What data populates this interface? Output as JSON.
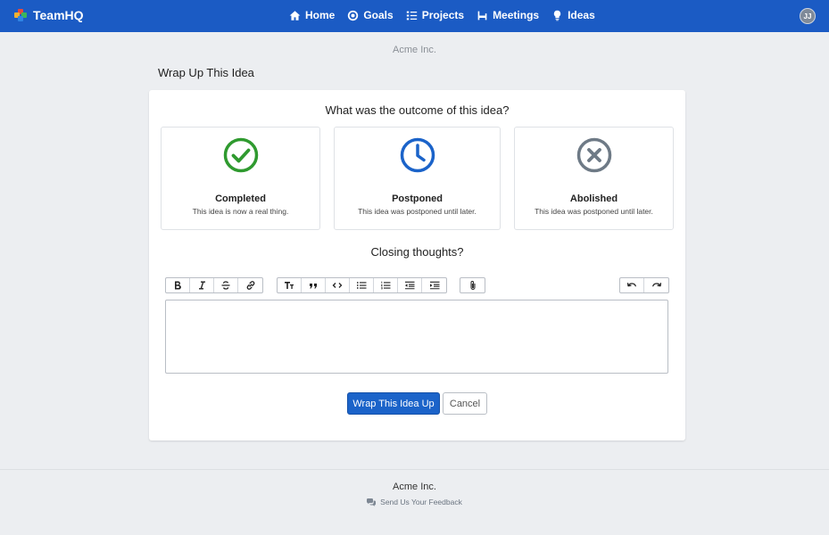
{
  "app": {
    "name": "TeamHQ",
    "user_initials": "JJ"
  },
  "nav": {
    "items": [
      {
        "label": "Home",
        "icon": "home-icon"
      },
      {
        "label": "Goals",
        "icon": "target-icon"
      },
      {
        "label": "Projects",
        "icon": "list-icon"
      },
      {
        "label": "Meetings",
        "icon": "chair-icon"
      },
      {
        "label": "Ideas",
        "icon": "lightbulb-icon"
      }
    ]
  },
  "org_name": "Acme Inc.",
  "page_title": "Wrap Up This Idea",
  "outcome": {
    "question": "What was the outcome of this idea?",
    "options": [
      {
        "title": "Completed",
        "description": "This idea is now a real thing.",
        "icon": "check-circle-icon",
        "color": "#2f9a2f"
      },
      {
        "title": "Postponed",
        "description": "This idea was postponed until later.",
        "icon": "clock-icon",
        "color": "#1b63c9"
      },
      {
        "title": "Abolished",
        "description": "This idea was postponed until later.",
        "icon": "x-circle-icon",
        "color": "#6e7a86"
      }
    ]
  },
  "closing": {
    "label": "Closing thoughts?",
    "editor_value": "",
    "toolbar": [
      [
        "bold-icon",
        "italic-icon",
        "strikethrough-icon",
        "link-icon"
      ],
      [
        "heading-icon",
        "quote-icon",
        "code-icon",
        "bullet-list-icon",
        "numbered-list-icon",
        "outdent-icon",
        "indent-icon"
      ],
      [
        "attach-icon"
      ],
      [
        "undo-icon",
        "redo-icon"
      ]
    ]
  },
  "actions": {
    "submit_label": "Wrap This Idea Up",
    "cancel_label": "Cancel"
  },
  "footer": {
    "org_name": "Acme Inc.",
    "feedback_label": "Send Us Your Feedback"
  },
  "colors": {
    "nav_bg": "#1b5bc4",
    "primary": "#1b63c9",
    "page_bg": "#eceef1"
  }
}
